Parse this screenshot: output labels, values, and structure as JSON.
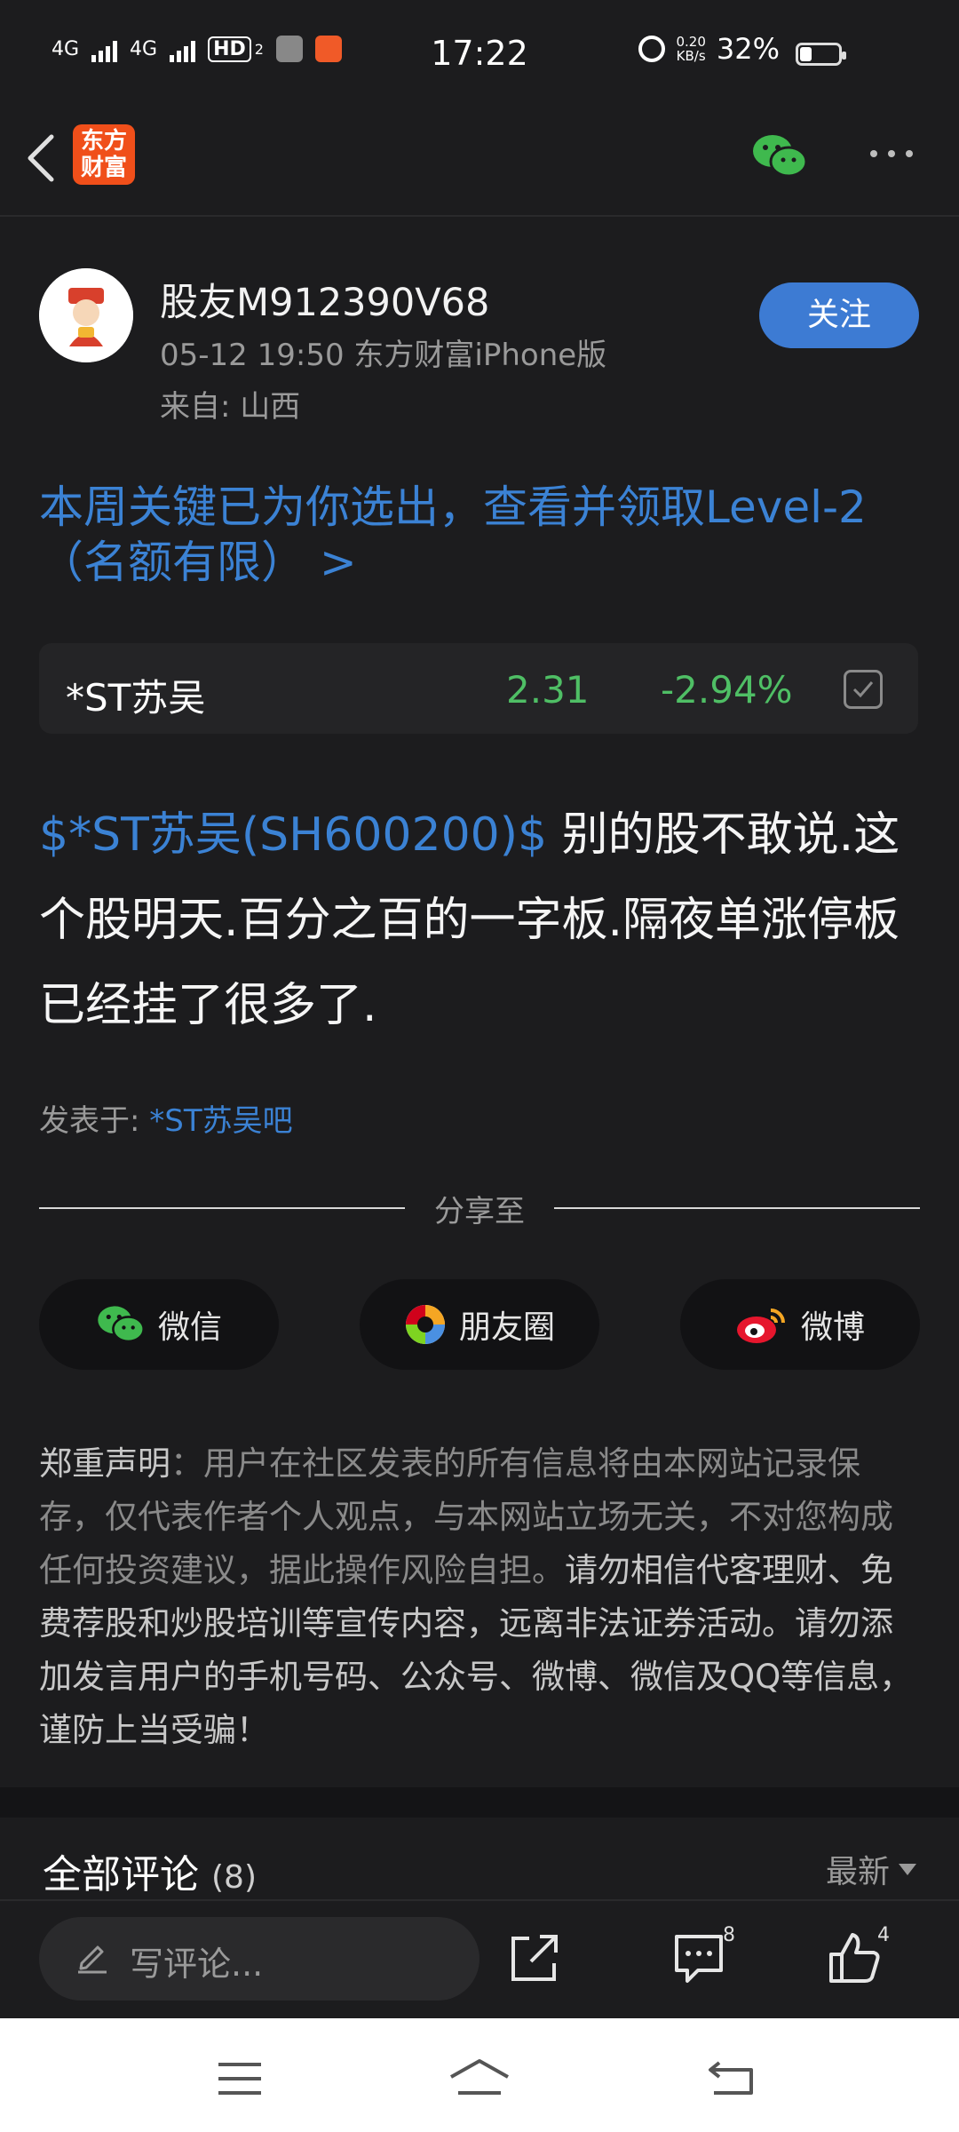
{
  "status_bar": {
    "network_1": "4G",
    "network_2": "4G",
    "hd": "HD",
    "hd_sub": "2",
    "time": "17:22",
    "speed_value": "0.20",
    "speed_unit": "KB/s",
    "battery_percent": "32%",
    "battery_level": 0.32
  },
  "nav": {
    "logo_line1": "东方",
    "logo_line2": "财富",
    "icons": [
      "back-icon",
      "wechat-icon",
      "more-icon"
    ]
  },
  "author": {
    "name": "股友M912390V68",
    "meta": "05-12 19:50 东方财富iPhone版",
    "from": "来自: 山西",
    "follow_label": "关注"
  },
  "promo_text": "本周关键已为你选出，查看并领取Level-2（名额有限） >",
  "stock": {
    "name": "*ST苏吴",
    "price": "2.31",
    "change": "-2.94%"
  },
  "post": {
    "tag": "$*ST苏吴(SH600200)$",
    "body": " 别的股不敢说.这个股明天.百分之百的一字板.隔夜单涨停板已经挂了很多了."
  },
  "posted_in": {
    "label": "发表于: ",
    "bar": "*ST苏吴吧"
  },
  "share": {
    "title": "分享至",
    "buttons": [
      {
        "label": "微信",
        "icon": "wechat-icon"
      },
      {
        "label": "朋友圈",
        "icon": "moments-icon"
      },
      {
        "label": "微博",
        "icon": "weibo-icon"
      }
    ]
  },
  "disclaimer": {
    "head": "郑重声明",
    "part1": "：用户在社区发表的所有信息将由本网站记录保存，仅代表作者个人观点，与本网站立场无关，不对您构成任何投资建议，据此操作风险自担。",
    "part2": "请勿相信代客理财、免费荐股和炒股培训等宣传内容，远离非法证券活动。请勿添加发言用户的手机号码、公众号、微博、微信及QQ等信息，谨防上当受骗！"
  },
  "comments": {
    "title": "全部评论",
    "count": "(8)",
    "sort_label": "最新"
  },
  "action_bar": {
    "placeholder": "写评论...",
    "comment_badge": "8",
    "like_badge": "4"
  },
  "colors": {
    "background": "#1c1c1e",
    "link_blue": "#3b82d4",
    "follow_blue": "#3d7bd3",
    "down_green": "#4fbf65",
    "logo_orange": "#f04f1a"
  }
}
